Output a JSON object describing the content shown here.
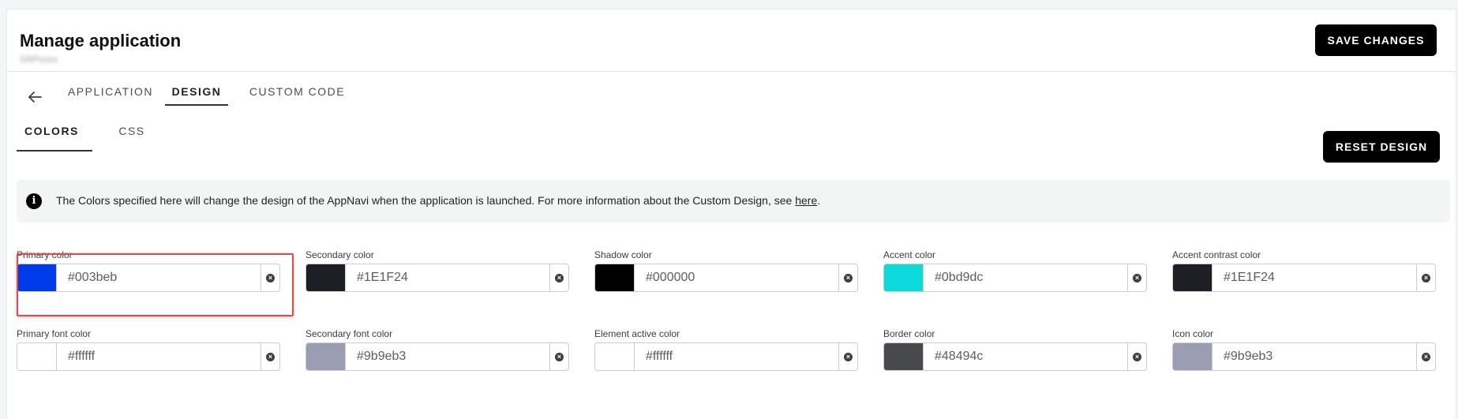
{
  "header": {
    "title": "Manage application",
    "subtitle": "SAPxxxx",
    "save_label": "SAVE CHANGES"
  },
  "tabs": [
    {
      "label": "APPLICATION",
      "active": false
    },
    {
      "label": "DESIGN",
      "active": true
    },
    {
      "label": "CUSTOM CODE",
      "active": false
    }
  ],
  "subtabs": [
    {
      "label": "COLORS",
      "active": true
    },
    {
      "label": "CSS",
      "active": false
    }
  ],
  "reset_label": "RESET DESIGN",
  "notice": {
    "text": "The Colors specified here will change the design of the AppNavi when the application is launched. For more information about the Custom Design, see ",
    "link": "here",
    "end": "."
  },
  "colors": [
    {
      "label": "Primary color",
      "value": "#003beb",
      "swatch": "#003beb"
    },
    {
      "label": "Secondary color",
      "value": "#1E1F24",
      "swatch": "#1E1F24"
    },
    {
      "label": "Shadow color",
      "value": "#000000",
      "swatch": "#000000"
    },
    {
      "label": "Accent color",
      "value": "#0bd9dc",
      "swatch": "#0bd9dc"
    },
    {
      "label": "Accent contrast color",
      "value": "#1E1F24",
      "swatch": "#1E1F24"
    },
    {
      "label": "Primary font color",
      "value": "#ffffff",
      "swatch": "#ffffff"
    },
    {
      "label": "Secondary font color",
      "value": "#9b9eb3",
      "swatch": "#9b9eb3"
    },
    {
      "label": "Element active color",
      "value": "#ffffff",
      "swatch": "#ffffff"
    },
    {
      "label": "Border color",
      "value": "#48494c",
      "swatch": "#48494c"
    },
    {
      "label": "Icon color",
      "value": "#9b9eb3",
      "swatch": "#9b9eb3"
    }
  ],
  "icons": {
    "back": "arrow-left-icon",
    "info": "info-icon",
    "clear": "clear-circle-icon"
  },
  "accent_highlight": "#e04a4a"
}
